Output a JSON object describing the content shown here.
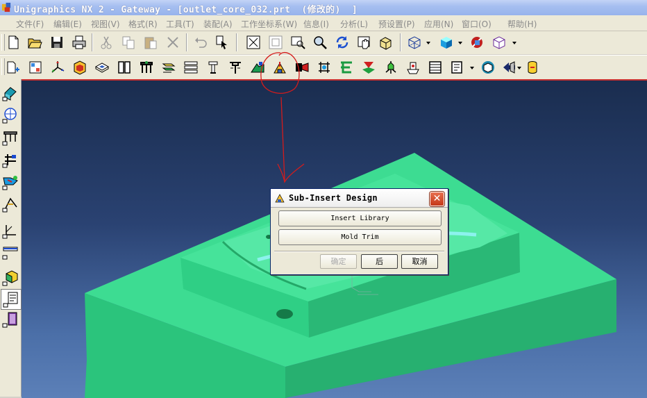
{
  "window": {
    "title": "Unigraphics NX 2 - Gateway - [outlet_core_032.prt  (修改的)  ]"
  },
  "menu": [
    {
      "label": "文件(F)"
    },
    {
      "label": "编辑(E)"
    },
    {
      "label": "视图(V)"
    },
    {
      "label": "格式(R)"
    },
    {
      "label": "工具(T)"
    },
    {
      "label": "装配(A)"
    },
    {
      "label": "工作坐标系(W)"
    },
    {
      "label": "信息(I)"
    },
    {
      "label": "分析(L)"
    },
    {
      "label": "预设置(P)"
    },
    {
      "label": "应用(N)"
    },
    {
      "label": "窗口(O)"
    },
    {
      "label": "帮助(H)"
    }
  ],
  "dialog": {
    "title": "Sub-Insert Design",
    "buttons": [
      "Insert Library",
      "Mold Trim"
    ],
    "ok_label": "确定",
    "back_label": "后",
    "cancel_label": "取消"
  },
  "colors": {
    "model": "#3fd990",
    "annotation": "#d41c1c",
    "viewport_top": "#1a2d4f",
    "viewport_bottom": "#5c80b8"
  }
}
